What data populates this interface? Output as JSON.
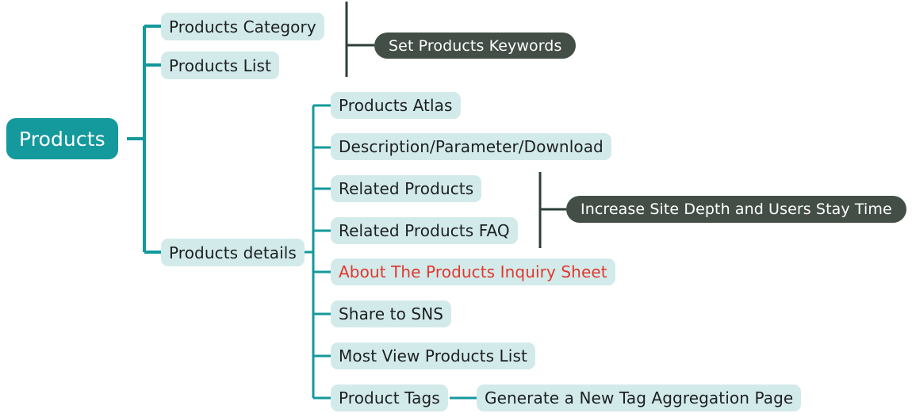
{
  "diagram": {
    "title": "Products",
    "type": "mind-map",
    "background_color": "#ffffff",
    "colors": {
      "root_fill": "#14999c",
      "root_text": "#ffffff",
      "pill_fill": "#d3eaea",
      "pill_text": "#1c2023",
      "alert_text": "#e0382e",
      "callout_fill": "#434e47",
      "callout_text": "#ffffff",
      "branch_line": "#14999c",
      "callout_line": "#2c3e38"
    }
  },
  "root": {
    "label": "Products"
  },
  "level1": [
    {
      "label": "Products Category"
    },
    {
      "label": "Products List"
    },
    {
      "label": "Products details"
    }
  ],
  "level2": [
    {
      "label": "Products Atlas",
      "style": "pill"
    },
    {
      "label": "Description/Parameter/Download",
      "style": "pill"
    },
    {
      "label": "Related Products",
      "style": "pill"
    },
    {
      "label": "Related Products FAQ",
      "style": "pill"
    },
    {
      "label": "About The Products Inquiry Sheet",
      "style": "alert"
    },
    {
      "label": "Share to SNS",
      "style": "pill"
    },
    {
      "label": "Most View Products List",
      "style": "pill"
    },
    {
      "label": "Product Tags",
      "style": "pill"
    }
  ],
  "level3": [
    {
      "label": "Generate a New Tag Aggregation Page"
    }
  ],
  "callouts": [
    {
      "label": "Set Products Keywords"
    },
    {
      "label": "Increase Site Depth and Users Stay Time"
    }
  ]
}
